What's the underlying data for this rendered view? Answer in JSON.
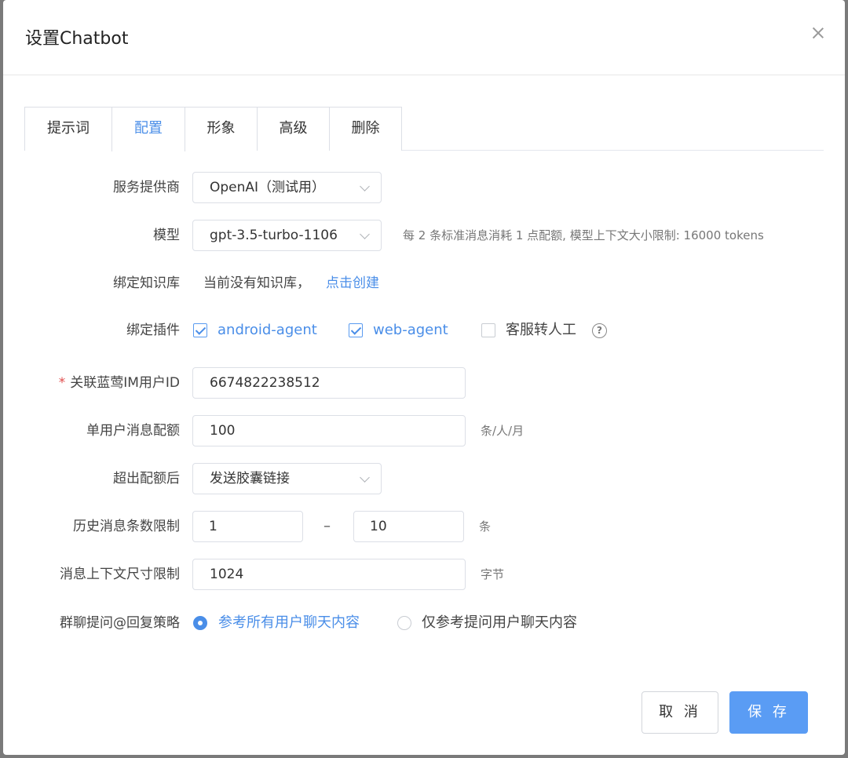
{
  "dialog": {
    "title": "设置Chatbot"
  },
  "tabs": [
    {
      "label": "提示词",
      "active": false
    },
    {
      "label": "配置",
      "active": true
    },
    {
      "label": "形象",
      "active": false
    },
    {
      "label": "高级",
      "active": false
    },
    {
      "label": "删除",
      "active": false
    }
  ],
  "form": {
    "provider": {
      "label": "服务提供商",
      "value": "OpenAI（测试用）"
    },
    "model": {
      "label": "模型",
      "value": "gpt-3.5-turbo-1106",
      "hint": "每 2 条标准消息消耗 1 点配额, 模型上下文大小限制: 16000 tokens"
    },
    "knowledge": {
      "label": "绑定知识库",
      "text": "当前没有知识库，",
      "link": "点击创建"
    },
    "plugins": {
      "label": "绑定插件",
      "items": [
        {
          "label": "android-agent",
          "checked": true
        },
        {
          "label": "web-agent",
          "checked": true
        },
        {
          "label": "客服转人工",
          "checked": false
        }
      ]
    },
    "im_user": {
      "required_mark": "*",
      "label": "关联蓝莺IM用户ID",
      "value": "6674822238512"
    },
    "quota": {
      "label": "单用户消息配额",
      "value": "100",
      "unit": "条/人/月"
    },
    "over_quota": {
      "label": "超出配额后",
      "value": "发送胶囊链接"
    },
    "history": {
      "label": "历史消息条数限制",
      "min": "1",
      "separator": "–",
      "max": "10",
      "unit": "条"
    },
    "context_size": {
      "label": "消息上下文尺寸限制",
      "value": "1024",
      "unit": "字节"
    },
    "group_policy": {
      "label": "群聊提问@回复策略",
      "options": [
        {
          "label": "参考所有用户聊天内容",
          "selected": true
        },
        {
          "label": "仅参考提问用户聊天内容",
          "selected": false
        }
      ]
    }
  },
  "footer": {
    "cancel_label": "取 消",
    "save_label": "保 存"
  },
  "colors": {
    "accent": "#4a8ee8",
    "primary_button": "#5a9cf4",
    "required": "#e04d4d"
  }
}
